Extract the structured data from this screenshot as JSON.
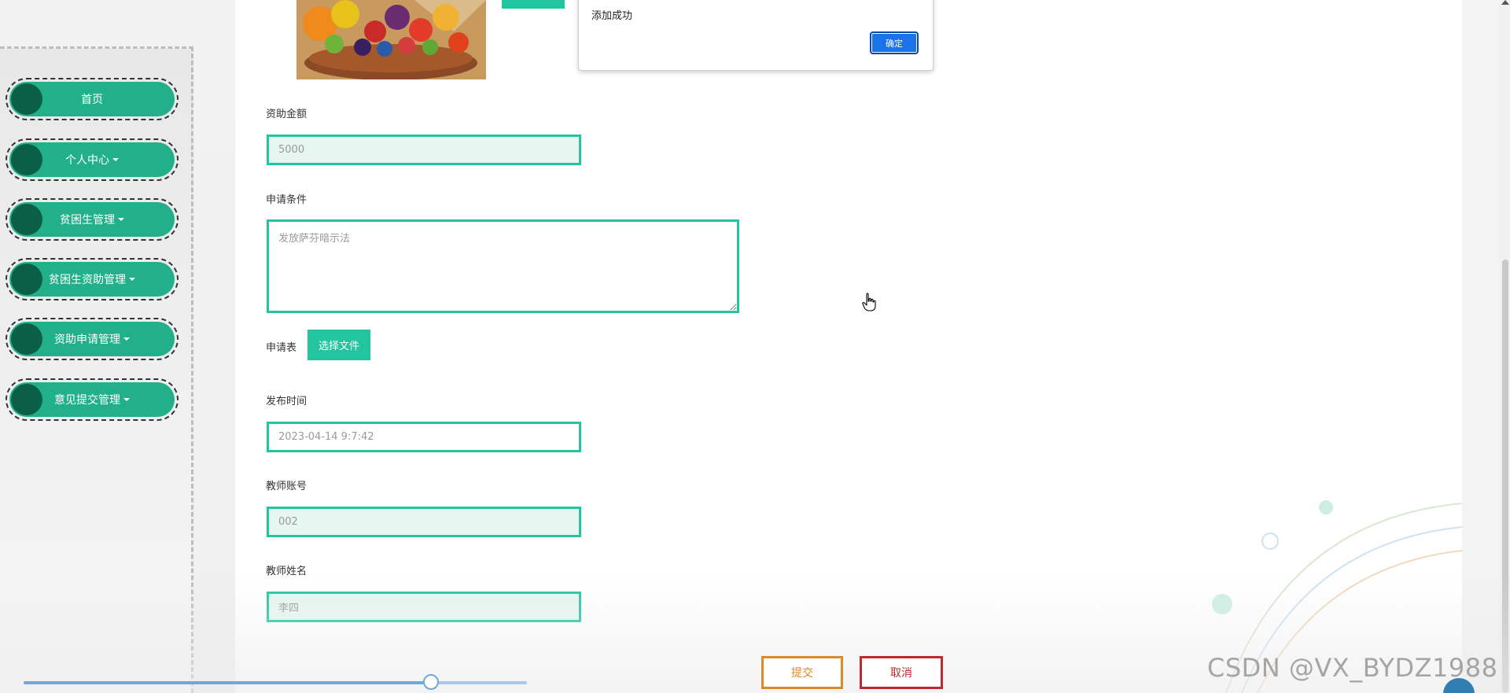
{
  "sidebar": {
    "items": [
      {
        "label": "首页",
        "has_dropdown": false
      },
      {
        "label": "个人中心",
        "has_dropdown": true
      },
      {
        "label": "贫困生管理",
        "has_dropdown": true
      },
      {
        "label": "贫困生资助管理",
        "has_dropdown": true
      },
      {
        "label": "资助申请管理",
        "has_dropdown": true
      },
      {
        "label": "意见提交管理",
        "has_dropdown": true
      }
    ]
  },
  "dialog": {
    "message": "添加成功",
    "ok_label": "确定"
  },
  "form": {
    "amount_label": "资助金额",
    "amount_value": "5000",
    "condition_label": "申请条件",
    "condition_value": "发放萨芬暗示法",
    "application_label": "申请表",
    "choose_file_label": "选择文件",
    "publish_time_label": "发布时间",
    "publish_time_value": "2023-04-14 9:7:42",
    "teacher_account_label": "教师账号",
    "teacher_account_value": "002",
    "teacher_name_label": "教师姓名",
    "teacher_name_value": "李四",
    "submit_label": "提交",
    "cancel_label": "取消"
  },
  "slider": {
    "value_fraction": 0.81
  },
  "watermark": "CSDN @VX_BYDZ1988",
  "colors": {
    "accent": "#22c5a0",
    "nav_green": "#22b08a",
    "nav_dot": "#0b5f46",
    "submit": "#d98b2a",
    "cancel": "#c0282d",
    "dialog_button": "#1a73e8"
  }
}
